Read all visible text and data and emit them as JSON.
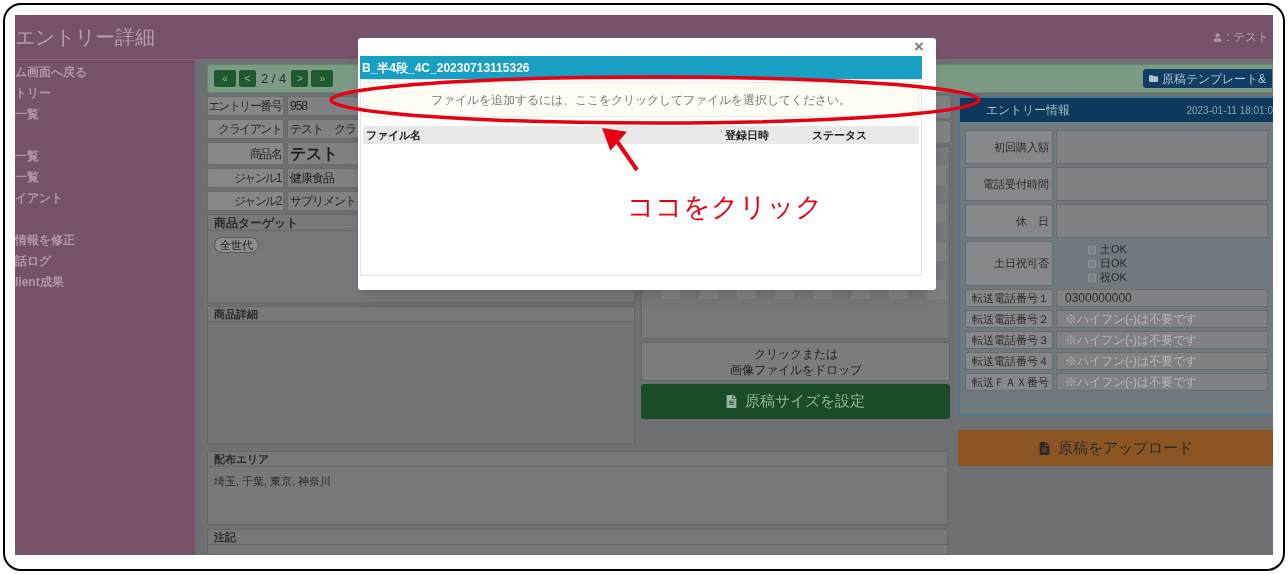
{
  "header": {
    "title": "エントリー詳細",
    "user": ": テスト"
  },
  "sidebar": {
    "items": [
      {
        "label": "ム画面へ戻る"
      },
      {
        "label": "トリー"
      },
      {
        "label": "一覧"
      },
      {
        "label": "一覧"
      },
      {
        "label": "一覧"
      },
      {
        "label": "イアント"
      },
      {
        "label": "情報を修正"
      },
      {
        "label": "話ログ"
      },
      {
        "label": "lient成果"
      }
    ]
  },
  "pager": {
    "first": "«",
    "prev": "<",
    "position": "2 / 4",
    "next": ">",
    "last": "»"
  },
  "template_button": "原稿テンプレート&",
  "fields": [
    {
      "label": "エントリー番号",
      "value": "958",
      "kind": "plain"
    },
    {
      "label": "クライアント",
      "value": "テスト　クラ",
      "kind": "plain"
    },
    {
      "label": "商品名",
      "value": "テスト",
      "kind": "large"
    },
    {
      "label": "ジャンル1",
      "value": "健康食品",
      "kind": "plain"
    },
    {
      "label": "ジャンル2",
      "value": "サプリメント",
      "kind": "plain"
    }
  ],
  "target": {
    "title": "商品ターゲット",
    "tags": [
      "全世代"
    ]
  },
  "detail": {
    "title": "商品詳細"
  },
  "image_drop": {
    "lines": [
      "クリックまたは",
      "画像ファイルをドロップ"
    ]
  },
  "size_button": "原稿サイズを設定",
  "area": {
    "title": "配布エリア",
    "value": "埼玉, 千葉, 東京, 神奈川"
  },
  "note": {
    "title": "注記"
  },
  "entry_info": {
    "title": "エントリー情報",
    "date": "2023-01-11 18:01:0",
    "rows": [
      {
        "label": "初回購入額",
        "kind": "tall"
      },
      {
        "label": "電話受付時間",
        "kind": "tall"
      },
      {
        "label": "休　日",
        "kind": "tall"
      },
      {
        "label": "土日祝可否",
        "kind": "checks",
        "options": [
          {
            "label": "土OK",
            "checked": false
          },
          {
            "label": "日OK",
            "checked": false
          },
          {
            "label": "祝OK",
            "checked": false
          }
        ]
      },
      {
        "label": "転送電話番号１",
        "kind": "input",
        "value": "0300000000"
      },
      {
        "label": "転送電話番号２",
        "kind": "input",
        "placeholder": "※ハイフン(-)は不要です"
      },
      {
        "label": "転送電話番号３",
        "kind": "input",
        "placeholder": "※ハイフン(-)は不要です"
      },
      {
        "label": "転送電話番号４",
        "kind": "input",
        "placeholder": "※ハイフン(-)は不要です"
      },
      {
        "label": "転送ＦＡＸ番号",
        "kind": "input",
        "placeholder": "※ハイフン(-)は不要です"
      }
    ]
  },
  "upload_button": "原稿をアップロード",
  "modal": {
    "close": "×",
    "title": "B_半4段_4C_20230713115326",
    "drop_text": "ファイルを追加するには、ここをクリックしてファイルを選択してください。",
    "columns": [
      "ファイル名",
      "登録日時",
      "ステータス"
    ]
  },
  "annotation": {
    "text": "ココをクリック"
  }
}
